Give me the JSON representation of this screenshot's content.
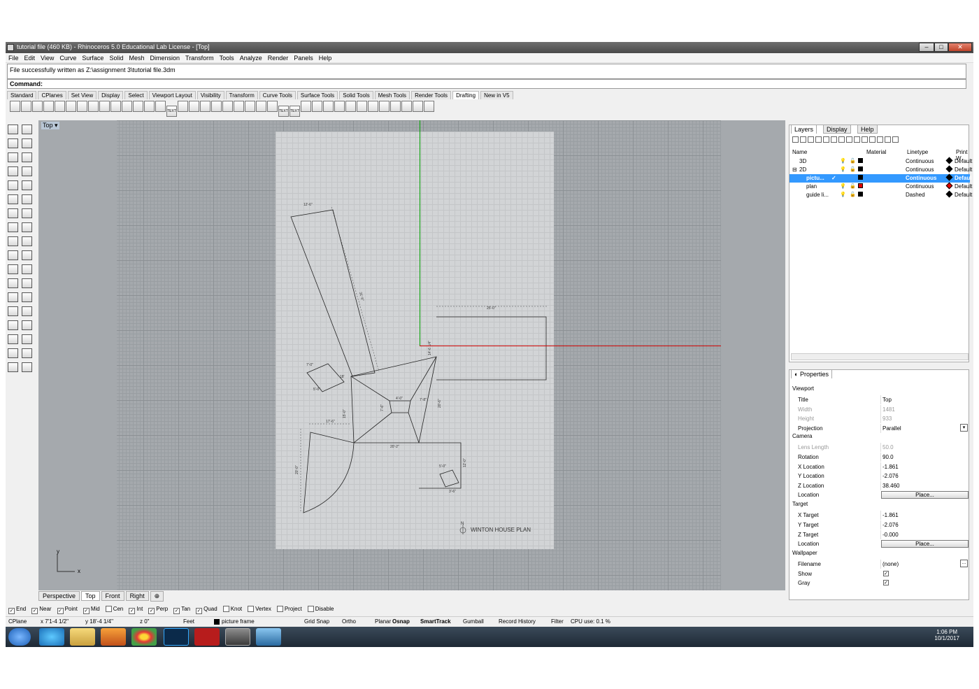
{
  "title": "tutorial file (460 KB) - Rhinoceros 5.0 Educational Lab License - [Top]",
  "menu": [
    "File",
    "Edit",
    "View",
    "Curve",
    "Surface",
    "Solid",
    "Mesh",
    "Dimension",
    "Transform",
    "Tools",
    "Analyze",
    "Render",
    "Panels",
    "Help"
  ],
  "history": "File successfully written as Z:\\assignment 3\\tutorial file.3dm",
  "command_label": "Command:",
  "toolbar_tabs": [
    "Standard",
    "CPlanes",
    "Set View",
    "Display",
    "Select",
    "Viewport Layout",
    "Visibility",
    "Transform",
    "Curve Tools",
    "Surface Tools",
    "Solid Tools",
    "Mesh Tools",
    "Render Tools",
    "Drafting",
    "New in V5"
  ],
  "active_toolbar_tab": "Drafting",
  "toolbar_text_icons": [
    "TEXT",
    "TEXT",
    "TEXT"
  ],
  "viewport": {
    "title": "Top",
    "axis_x": "x",
    "axis_y": "y",
    "tabs": [
      "Perspective",
      "Top",
      "Front",
      "Right"
    ],
    "plan_label": "WINTON HOUSE PLAN",
    "north": "N",
    "dims": [
      "12'-6\"",
      "31'-6\"",
      "25'-0\"",
      "14'-6 1/4\"",
      "7'-0\"",
      "5'-0\"",
      "18'",
      "20'-6\"",
      "15'-0\"",
      "4'-0\"",
      "7'-6\"",
      "7'-8\"",
      "20'-2\"",
      "12'-0\"",
      "17'-6\"",
      "20'-0\"",
      "3'-6\"",
      "5'-0\""
    ]
  },
  "layers_panel": {
    "tabs": [
      "Layers",
      "Display",
      "Help"
    ],
    "columns": [
      "Name",
      "Material",
      "Linetype",
      "Print W"
    ],
    "rows": [
      {
        "name": "3D",
        "linetype": "Continuous",
        "print": "Default",
        "color": "#000000"
      },
      {
        "name": "2D",
        "linetype": "Continuous",
        "print": "Default",
        "color": "#000000"
      },
      {
        "name": "pictu...",
        "linetype": "Continuous",
        "print": "Defaul",
        "color": "#000000",
        "selected": true
      },
      {
        "name": "plan",
        "linetype": "Continuous",
        "print": "Default",
        "color": "#e00000"
      },
      {
        "name": "guide li...",
        "linetype": "Dashed",
        "print": "Default",
        "color": "#000000"
      }
    ]
  },
  "properties": {
    "title": "Properties",
    "sections": {
      "viewport": "Viewport",
      "camera": "Camera",
      "target": "Target",
      "wallpaper": "Wallpaper"
    },
    "viewport_rows": [
      {
        "k": "Title",
        "v": "Top"
      },
      {
        "k": "Width",
        "v": "1481",
        "dim": true
      },
      {
        "k": "Height",
        "v": "933",
        "dim": true
      },
      {
        "k": "Projection",
        "v": "Parallel"
      }
    ],
    "camera_rows": [
      {
        "k": "Lens Length",
        "v": "50.0",
        "dim": true
      },
      {
        "k": "Rotation",
        "v": "90.0"
      },
      {
        "k": "X Location",
        "v": "-1.861"
      },
      {
        "k": "Y Location",
        "v": "-2.076"
      },
      {
        "k": "Z Location",
        "v": "38.460"
      }
    ],
    "camera_location": "Location",
    "place_button": "Place...",
    "target_rows": [
      {
        "k": "X Target",
        "v": "-1.861"
      },
      {
        "k": "Y Target",
        "v": "-2.076"
      },
      {
        "k": "Z Target",
        "v": "-0.000"
      }
    ],
    "target_location": "Location",
    "wallpaper_rows": [
      {
        "k": "Filename",
        "v": "(none)"
      },
      {
        "k": "Show",
        "v": "✓"
      },
      {
        "k": "Gray",
        "v": "✓"
      }
    ],
    "ellipsis": "..."
  },
  "osnaps": [
    {
      "label": "End",
      "checked": true
    },
    {
      "label": "Near",
      "checked": true
    },
    {
      "label": "Point",
      "checked": true
    },
    {
      "label": "Mid",
      "checked": true
    },
    {
      "label": "Cen",
      "checked": false
    },
    {
      "label": "Int",
      "checked": true
    },
    {
      "label": "Perp",
      "checked": true
    },
    {
      "label": "Tan",
      "checked": true
    },
    {
      "label": "Quad",
      "checked": true
    },
    {
      "label": "Knot",
      "checked": false
    },
    {
      "label": "Vertex",
      "checked": false
    },
    {
      "label": "Project",
      "checked": false
    },
    {
      "label": "Disable",
      "checked": false
    }
  ],
  "status": {
    "cplane": "CPlane",
    "x": "x 7'1-4 1/2\"",
    "y": "y 18'-4 1/4\"",
    "z": "z 0\"",
    "units": "Feet",
    "layer": "picture frame",
    "toggles": [
      "Grid Snap",
      "Ortho",
      "Planar",
      "Osnap",
      "SmartTrack",
      "Gumball",
      "Record History",
      "Filter"
    ],
    "cpu": "CPU use: 0.1 %"
  },
  "clock": {
    "time": "1:06 PM",
    "date": "10/1/2017"
  },
  "colors": {
    "selection": "#3399ff",
    "x_axis": "#cc0000",
    "y_axis": "#00a000"
  }
}
